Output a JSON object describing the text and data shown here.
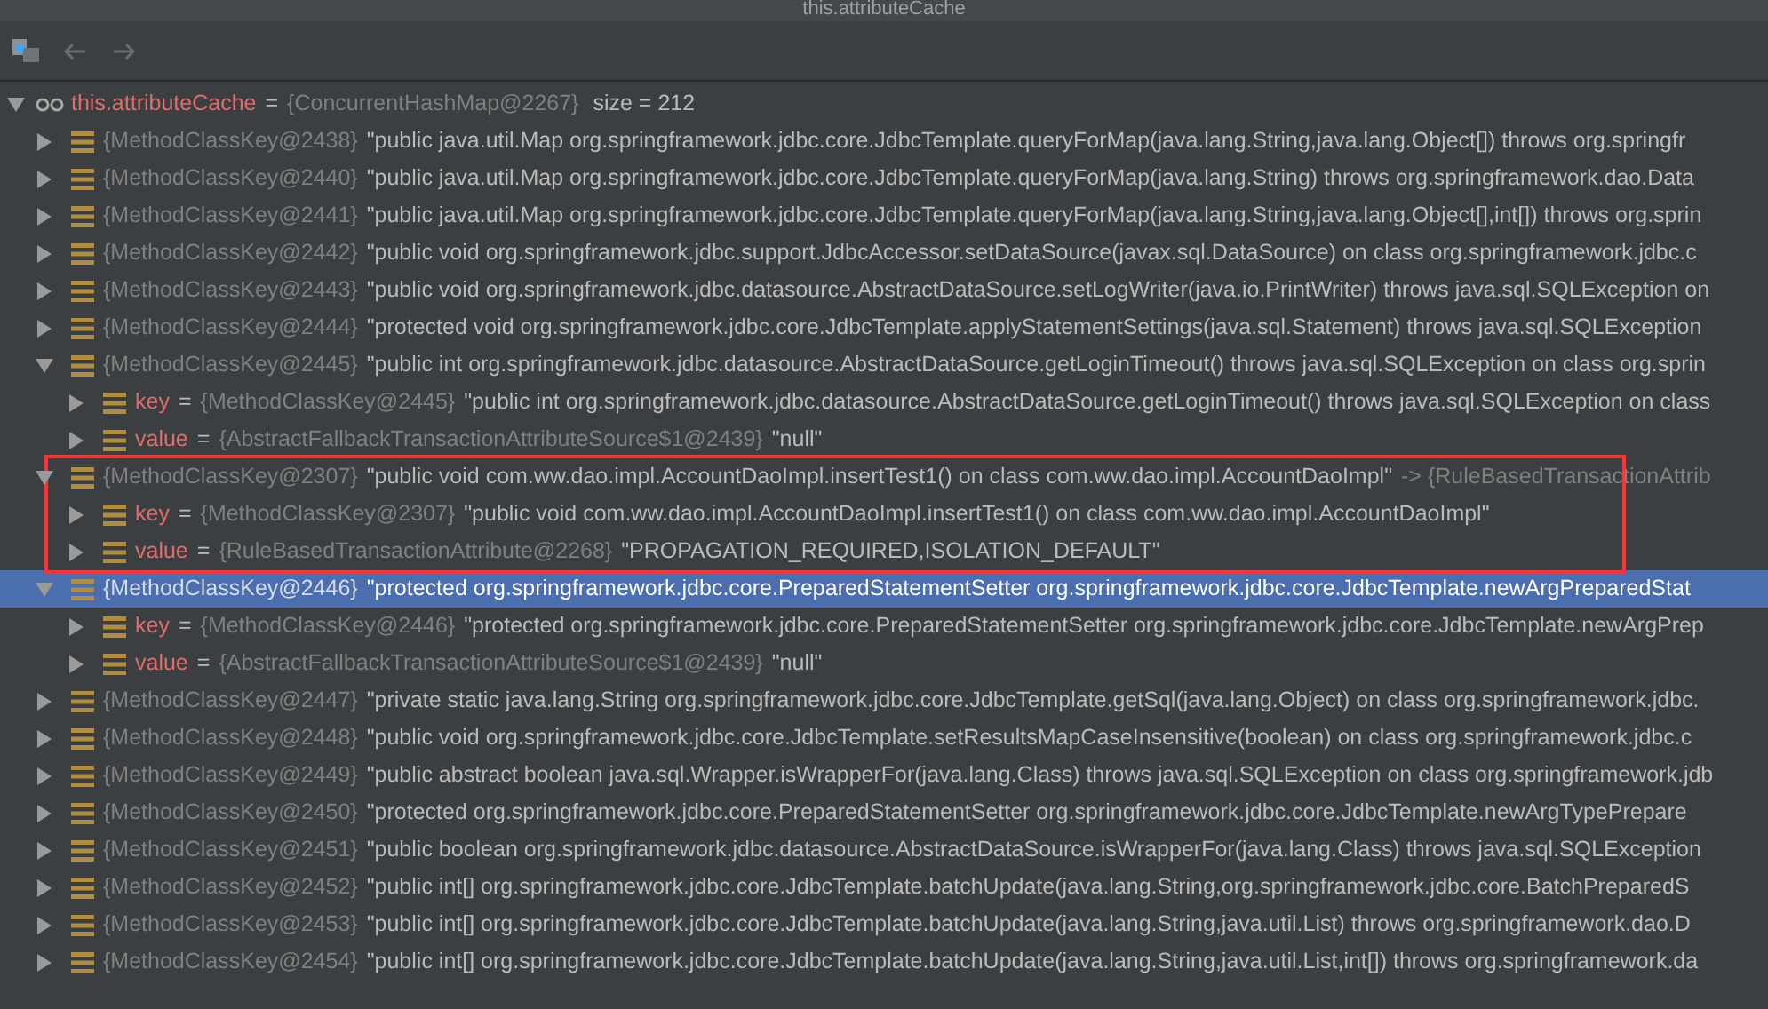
{
  "window": {
    "title": "this.attributeCache"
  },
  "root": {
    "name": "this.attributeCache",
    "separator": "=",
    "ref": "{ConcurrentHashMap@2267}",
    "size": "size = 212",
    "expanded": true
  },
  "entries": [
    {
      "ref": "{MethodClassKey@2438}",
      "text": "\"public java.util.Map org.springframework.jdbc.core.JdbcTemplate.queryForMap(java.lang.String,java.lang.Object[]) throws org.springfr",
      "expanded": false,
      "selected": false,
      "boxed": false
    },
    {
      "ref": "{MethodClassKey@2440}",
      "text": "\"public java.util.Map org.springframework.jdbc.core.JdbcTemplate.queryForMap(java.lang.String) throws org.springframework.dao.Data",
      "expanded": false,
      "selected": false,
      "boxed": false
    },
    {
      "ref": "{MethodClassKey@2441}",
      "text": "\"public java.util.Map org.springframework.jdbc.core.JdbcTemplate.queryForMap(java.lang.String,java.lang.Object[],int[]) throws org.sprin",
      "expanded": false,
      "selected": false,
      "boxed": false
    },
    {
      "ref": "{MethodClassKey@2442}",
      "text": "\"public void org.springframework.jdbc.support.JdbcAccessor.setDataSource(javax.sql.DataSource) on class org.springframework.jdbc.c",
      "expanded": false,
      "selected": false,
      "boxed": false
    },
    {
      "ref": "{MethodClassKey@2443}",
      "text": "\"public void org.springframework.jdbc.datasource.AbstractDataSource.setLogWriter(java.io.PrintWriter) throws java.sql.SQLException on",
      "expanded": false,
      "selected": false,
      "boxed": false
    },
    {
      "ref": "{MethodClassKey@2444}",
      "text": "\"protected void org.springframework.jdbc.core.JdbcTemplate.applyStatementSettings(java.sql.Statement) throws java.sql.SQLException",
      "expanded": false,
      "selected": false,
      "boxed": false
    },
    {
      "ref": "{MethodClassKey@2445}",
      "text": "\"public int org.springframework.jdbc.datasource.AbstractDataSource.getLoginTimeout() throws java.sql.SQLException on class org.sprin",
      "expanded": true,
      "selected": false,
      "children": [
        {
          "name": "key",
          "separator": "=",
          "ref": "{MethodClassKey@2445}",
          "text": "\"public int org.springframework.jdbc.datasource.AbstractDataSource.getLoginTimeout() throws java.sql.SQLException on class"
        },
        {
          "name": "value",
          "separator": "=",
          "ref": "{AbstractFallbackTransactionAttributeSource$1@2439}",
          "text": "\"null\""
        }
      ]
    },
    {
      "ref": "{MethodClassKey@2307}",
      "text": "\"public void com.ww.dao.impl.AccountDaoImpl.insertTest1() on class com.ww.dao.impl.AccountDaoImpl\"",
      "arrow": "-> {RuleBasedTransactionAttrib",
      "expanded": true,
      "selected": false,
      "boxed": true,
      "children": [
        {
          "name": "key",
          "separator": "=",
          "ref": "{MethodClassKey@2307}",
          "text": "\"public void com.ww.dao.impl.AccountDaoImpl.insertTest1() on class com.ww.dao.impl.AccountDaoImpl\""
        },
        {
          "name": "value",
          "separator": "=",
          "ref": "{RuleBasedTransactionAttribute@2268}",
          "text": "\"PROPAGATION_REQUIRED,ISOLATION_DEFAULT\""
        }
      ]
    },
    {
      "ref": "{MethodClassKey@2446}",
      "text": "\"protected org.springframework.jdbc.core.PreparedStatementSetter org.springframework.jdbc.core.JdbcTemplate.newArgPreparedStat",
      "expanded": true,
      "selected": true,
      "children": [
        {
          "name": "key",
          "separator": "=",
          "ref": "{MethodClassKey@2446}",
          "text": "\"protected org.springframework.jdbc.core.PreparedStatementSetter org.springframework.jdbc.core.JdbcTemplate.newArgPrep"
        },
        {
          "name": "value",
          "separator": "=",
          "ref": "{AbstractFallbackTransactionAttributeSource$1@2439}",
          "text": "\"null\""
        }
      ]
    },
    {
      "ref": "{MethodClassKey@2447}",
      "text": "\"private static java.lang.String org.springframework.jdbc.core.JdbcTemplate.getSql(java.lang.Object) on class org.springframework.jdbc.",
      "expanded": false,
      "selected": false,
      "boxed": false
    },
    {
      "ref": "{MethodClassKey@2448}",
      "text": "\"public void org.springframework.jdbc.core.JdbcTemplate.setResultsMapCaseInsensitive(boolean) on class org.springframework.jdbc.c",
      "expanded": false,
      "selected": false,
      "boxed": false
    },
    {
      "ref": "{MethodClassKey@2449}",
      "text": "\"public abstract boolean java.sql.Wrapper.isWrapperFor(java.lang.Class) throws java.sql.SQLException on class org.springframework.jdb",
      "expanded": false,
      "selected": false,
      "boxed": false
    },
    {
      "ref": "{MethodClassKey@2450}",
      "text": "\"protected org.springframework.jdbc.core.PreparedStatementSetter org.springframework.jdbc.core.JdbcTemplate.newArgTypePrepare",
      "expanded": false,
      "selected": false,
      "boxed": false
    },
    {
      "ref": "{MethodClassKey@2451}",
      "text": "\"public boolean org.springframework.jdbc.datasource.AbstractDataSource.isWrapperFor(java.lang.Class) throws java.sql.SQLException",
      "expanded": false,
      "selected": false,
      "boxed": false
    },
    {
      "ref": "{MethodClassKey@2452}",
      "text": "\"public int[] org.springframework.jdbc.core.JdbcTemplate.batchUpdate(java.lang.String,org.springframework.jdbc.core.BatchPreparedS",
      "expanded": false,
      "selected": false,
      "boxed": false
    },
    {
      "ref": "{MethodClassKey@2453}",
      "text": "\"public int[] org.springframework.jdbc.core.JdbcTemplate.batchUpdate(java.lang.String,java.util.List) throws org.springframework.dao.D",
      "expanded": false,
      "selected": false,
      "boxed": false
    },
    {
      "ref": "{MethodClassKey@2454}",
      "text": "\"public int[] org.springframework.jdbc.core.JdbcTemplate.batchUpdate(java.lang.String,java.util.List,int[]) throws org.springframework.da",
      "expanded": false,
      "selected": false,
      "boxed": false
    }
  ]
}
